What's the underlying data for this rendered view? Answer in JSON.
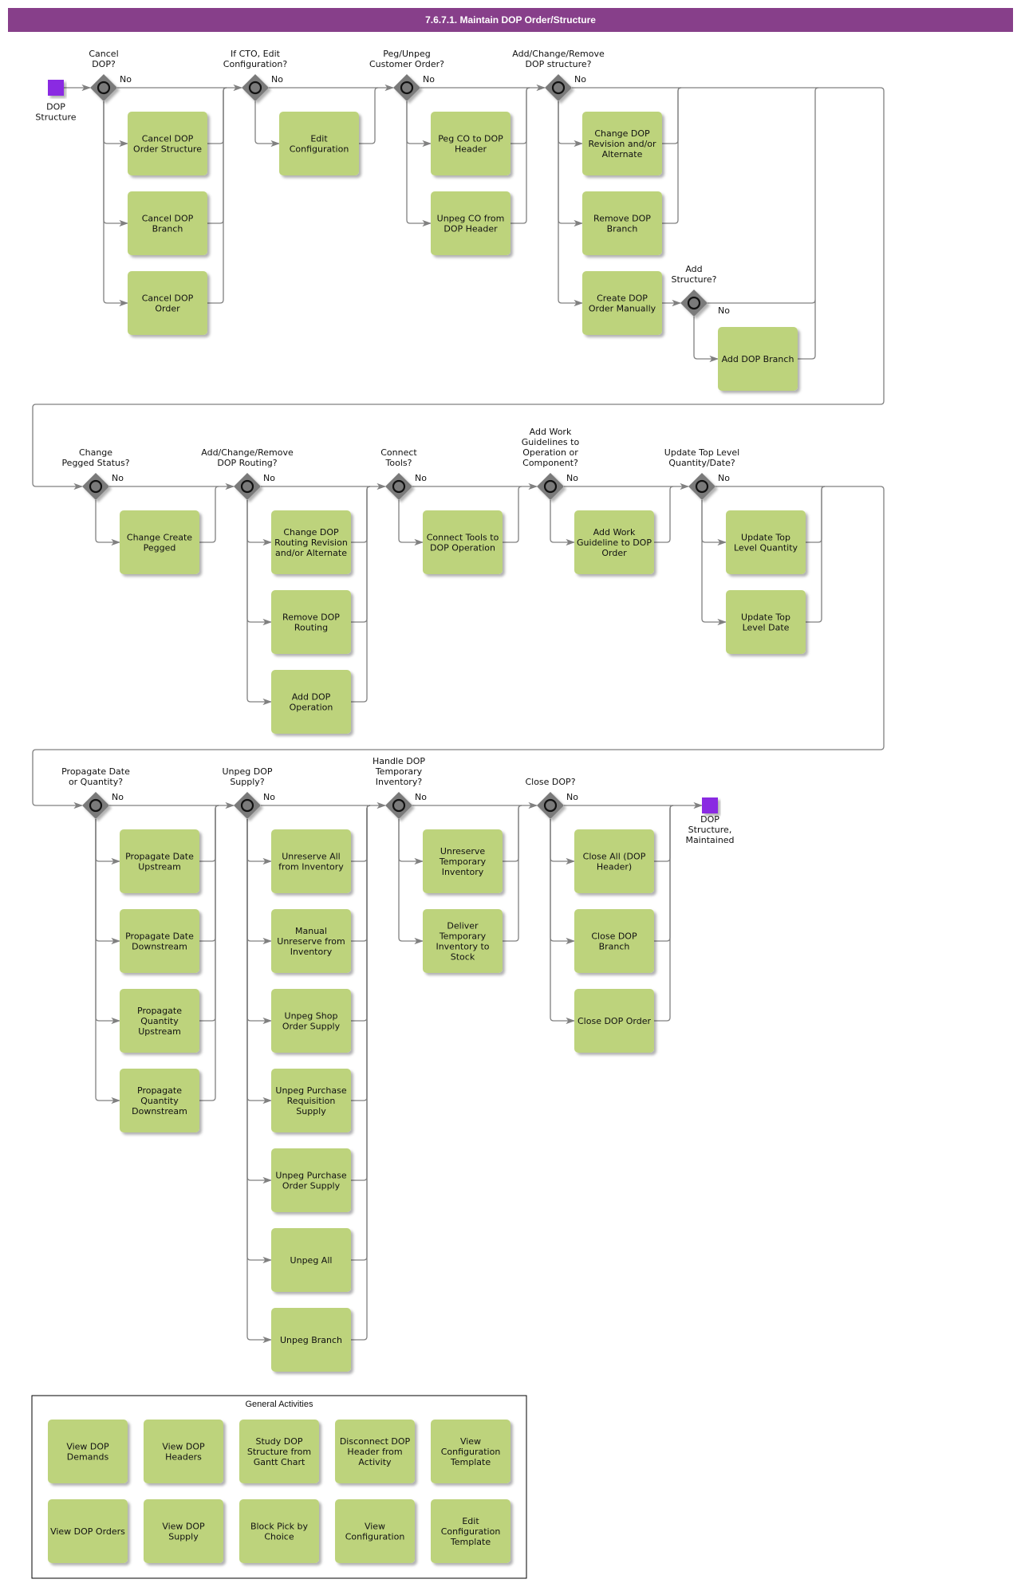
{
  "title": "7.6.7.1. Maintain DOP Order/Structure",
  "colors": {
    "title_bar": "#873f8a",
    "task_fill": "#bdd37c",
    "event_fill": "#8a2be2",
    "gateway_fill": "#7a7a7a",
    "connector": "#808080"
  },
  "start_event": {
    "label": "DOP Structure"
  },
  "end_event": {
    "label": "DOP Structure, Maintained"
  },
  "no_label": "No",
  "rows": [
    {
      "gateways": [
        {
          "question": "Cancel DOP?",
          "tasks": [
            "Cancel DOP Order Structure",
            "Cancel DOP Branch",
            "Cancel DOP Order"
          ]
        },
        {
          "question": "If CTO, Edit Configuration?",
          "tasks": [
            "Edit Configuration"
          ]
        },
        {
          "question": "Peg/Unpeg Customer Order?",
          "tasks": [
            "Peg CO to DOP Header",
            "Unpeg CO from DOP Header"
          ]
        },
        {
          "question": "Add/Change/Remove DOP structure?",
          "tasks": [
            "Change DOP Revision and/or Alternate",
            "Remove DOP Branch",
            "Create DOP Order Manually"
          ],
          "sub_gateway": {
            "question": "Add Structure?",
            "tasks": [
              "Add DOP Branch"
            ]
          }
        }
      ]
    },
    {
      "gateways": [
        {
          "question": "Change Pegged Status?",
          "tasks": [
            "Change Create Pegged"
          ]
        },
        {
          "question": "Add/Change/Remove DOP Routing?",
          "tasks": [
            "Change DOP Routing Revision and/or Alternate",
            "Remove DOP Routing",
            "Add DOP Operation"
          ]
        },
        {
          "question": "Connect Tools?",
          "tasks": [
            "Connect Tools to DOP Operation"
          ]
        },
        {
          "question": "Add Work Guidelines to Operation or Component?",
          "tasks": [
            "Add Work Guideline to DOP Order"
          ]
        },
        {
          "question": "Update Top Level Quantity/Date?",
          "tasks": [
            "Update Top Level Quantity",
            "Update Top Level Date"
          ]
        }
      ]
    },
    {
      "gateways": [
        {
          "question": "Propagate Date or Quantity?",
          "tasks": [
            "Propagate Date Upstream",
            "Propagate Date Downstream",
            "Propagate Quantity Upstream",
            "Propagate Quantity Downstream"
          ]
        },
        {
          "question": "Unpeg DOP Supply?",
          "tasks": [
            "Unreserve All from Inventory",
            "Manual Unreserve from Inventory",
            "Unpeg Shop Order Supply",
            "Unpeg Purchase Requisition Supply",
            "Unpeg Purchase Order Supply",
            "Unpeg All",
            "Unpeg Branch"
          ]
        },
        {
          "question": "Handle DOP Temporary Inventory?",
          "tasks": [
            "Unreserve Temporary Inventory",
            "Deliver Temporary Inventory to Stock"
          ]
        },
        {
          "question": "Close DOP?",
          "tasks": [
            "Close All (DOP Header)",
            "Close DOP Branch",
            "Close DOP Order"
          ]
        }
      ]
    }
  ],
  "general_activities": {
    "title": "General Activities",
    "tasks": [
      "View DOP Demands",
      "View DOP Headers",
      "Study DOP Structure from Gantt Chart",
      "Disconnect DOP Header from Activity",
      "View Configuration Template",
      "View DOP Orders",
      "View DOP Supply",
      "Block Pick by Choice",
      "View Configuration",
      "Edit Configuration Template"
    ]
  }
}
